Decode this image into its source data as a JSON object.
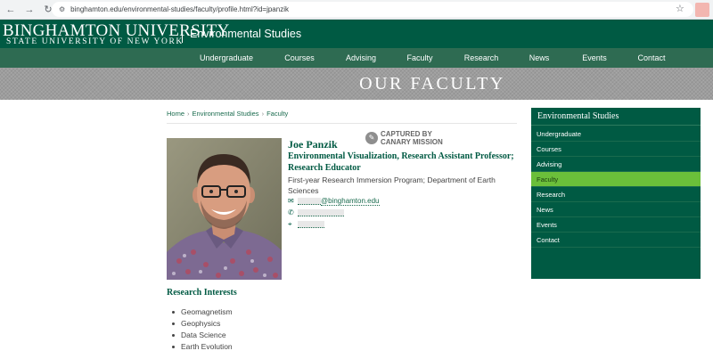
{
  "browser": {
    "url": "binghamton.edu/environmental-studies/faculty/profile.html?id=jpanzik"
  },
  "site": {
    "logo_line1": "BINGHAMTON UNIVERSITY",
    "logo_line2": "STATE UNIVERSITY OF NEW YORK",
    "department": "Environmental Studies"
  },
  "nav": {
    "items": [
      "Undergraduate",
      "Courses",
      "Advising",
      "Faculty",
      "Research",
      "News",
      "Events",
      "Contact"
    ]
  },
  "banner": {
    "title": "OUR FACULTY"
  },
  "breadcrumb": {
    "items": [
      "Home",
      "Environmental Studies",
      "Faculty"
    ],
    "separator": "›"
  },
  "watermark": {
    "line1": "CAPTURED BY",
    "line2": "CANARY MISSION"
  },
  "profile": {
    "name": "Joe Panzik",
    "title": "Environmental Visualization, Research Assistant Professor; Research Educator",
    "department": "First-year Research Immersion Program; Department of Earth Sciences",
    "email_visible": "@binghamton.edu"
  },
  "research": {
    "heading": "Research Interests",
    "items": [
      "Geomagnetism",
      "Geophysics",
      "Data Science",
      "Earth Evolution"
    ]
  },
  "sidebar": {
    "title": "Environmental Studies",
    "items": [
      "Undergraduate",
      "Courses",
      "Advising",
      "Faculty",
      "Research",
      "News",
      "Events",
      "Contact"
    ],
    "active": "Faculty"
  },
  "colors": {
    "brand_green": "#005a43",
    "nav_green": "#2e6b52",
    "active_green": "#6bbf3a"
  }
}
